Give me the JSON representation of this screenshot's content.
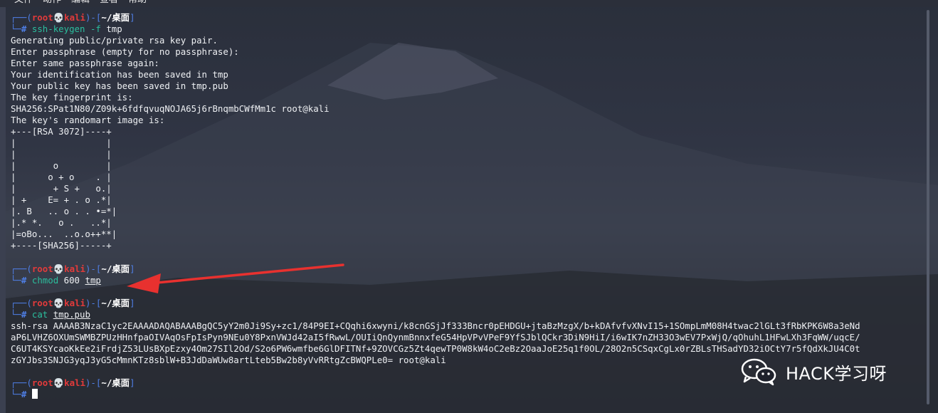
{
  "menubar": {
    "items": [
      "文件",
      "动作",
      "编辑",
      "查看",
      "帮助"
    ]
  },
  "prompt": {
    "user": "root",
    "skull": "💀",
    "host": "kali",
    "path": "~/桌面",
    "hash": "#"
  },
  "commands": {
    "c1": {
      "name": "ssh-keygen",
      "flag": "-f",
      "arg": "tmp"
    },
    "c2": {
      "name": "chmod",
      "mode": "600",
      "arg": "tmp"
    },
    "c3": {
      "name": "cat",
      "arg": "tmp.pub"
    }
  },
  "output1": [
    "Generating public/private rsa key pair.",
    "Enter passphrase (empty for no passphrase):",
    "Enter same passphrase again:",
    "Your identification has been saved in tmp",
    "Your public key has been saved in tmp.pub",
    "The key fingerprint is:",
    "SHA256:SPat1N80/Z09k+6fdfqvuqNOJA65j6rBnqmbCWfMm1c root@kali",
    "The key's randomart image is:"
  ],
  "randomart": [
    "+---[RSA 3072]----+",
    "|                 |",
    "|                 |",
    "|       o         |",
    "|      o + o    . |",
    "|       + S +   o.|",
    "| +    E= + . o .*|",
    "|. B   .. o . . •=*|",
    "|.* *.   o .   ..*|",
    "|=oBo...  ..o.o++**|",
    "+----[SHA256]-----+"
  ],
  "pubkey": [
    "ssh-rsa AAAAB3NzaC1yc2EAAAADAQABAAABgQC5yY2m0Ji9Sy+zc1/84P9EI+CQqhi6xwyni/k8cnGSjJf333Bncr0pEHDGU+jtaBzMzgX/b+kDAfvfvXNvI15+1SOmpLmM08H4twac2lGLt3fRbKPK6W8a3eNd",
    "aP6LVHZ6OXUmSWMBZPUzHHnfpaOIVAqOsFpIsPyn9NEu0Y8PxnVWJd42aI5fRwwL/OUIiQnQynmBnnxfeG54HpVPvVPeF9YfSJblQCkr3DiN9HiI/i6wIK7nZH33O3wEV7PxWjQ/qOhuhL1HFwLXh3FqWW/uqcE/",
    "C6UT4KSYcaoKkEe2iFrdjZ53LUsBXpEzxy4Om27SIl2Od/S2o6PW6wmfbe6GlDFITNf+9ZOVCGz5Zt4qewTP0W8kW4oC2eBz2OaaJoE25q1f0OL/28O2n5CSqxCgLx0rZBLsTHSadYD32iOCtY7r5fQdXkJU4C0t",
    "zGYJbs3SNJG3yqJ3yG5cMmnKTz8sblW+B3JdDaWUw8artLteb5Bw2b8yVvRRtgZcBWQPLe0= root@kali"
  ],
  "watermark": {
    "text": "HACK学习呀",
    "icon": "wechat-icon"
  },
  "colors": {
    "box": "#4f7fe6",
    "user": "#e23b3b",
    "command": "#2bbf9e",
    "arrow": "#e8312f"
  }
}
